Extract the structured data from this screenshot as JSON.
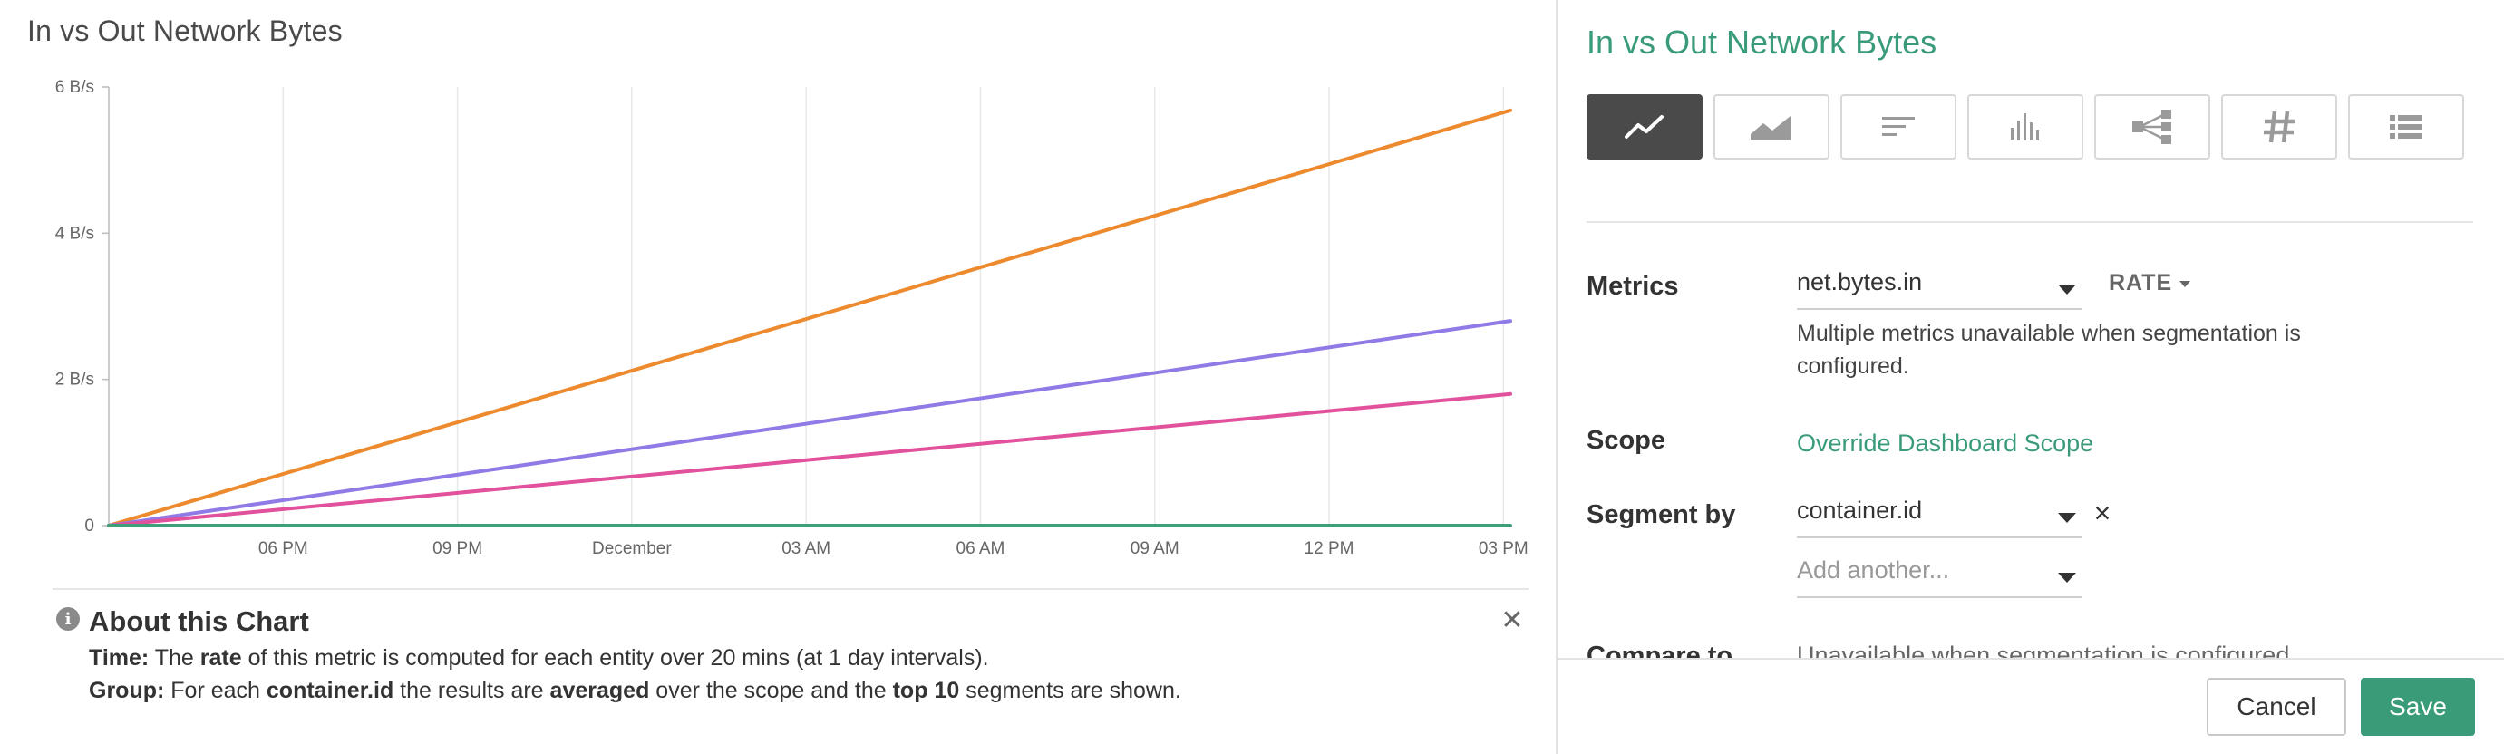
{
  "chart_panel": {
    "title": "In vs Out Network Bytes",
    "about": {
      "heading": "About this Chart",
      "line1": {
        "label": "Time:",
        "t1": "The",
        "rate": "rate",
        "t2": "of this metric is computed for each entity over 20 mins (at 1 day intervals)."
      },
      "line2": {
        "label": "Group:",
        "t1": "For each",
        "entity": "container.id",
        "t2": "the results are",
        "agg": "averaged",
        "t3": "over the scope and the",
        "top": "top 10",
        "t4": "segments are shown."
      }
    }
  },
  "chart_data": {
    "type": "line",
    "title": "In vs Out Network Bytes",
    "x_ticks": [
      "06 PM",
      "09 PM",
      "December",
      "03 AM",
      "06 AM",
      "09 AM",
      "12 PM",
      "03 PM"
    ],
    "y_ticks": [
      "0",
      "2 B/s",
      "4 B/s",
      "6 B/s"
    ],
    "x_range": [
      0,
      24.12
    ],
    "ylim": [
      0,
      6
    ],
    "grid": true,
    "series": [
      {
        "color": "#ee8a2e",
        "x": [
          0,
          24.12
        ],
        "values": [
          0,
          5.68
        ]
      },
      {
        "color": "#8f7ae6",
        "x": [
          0,
          24.12
        ],
        "values": [
          0,
          2.8
        ]
      },
      {
        "color": "#e2519c",
        "x": [
          0,
          24.12
        ],
        "values": [
          0,
          1.8
        ]
      },
      {
        "color": "#3da07b",
        "x": [
          0,
          24.12
        ],
        "values": [
          0,
          0
        ]
      }
    ]
  },
  "editor": {
    "title": "In vs Out Network Bytes",
    "viz_types": [
      {
        "icon": "line-chart-icon",
        "active": true
      },
      {
        "icon": "area-chart-icon",
        "active": false
      },
      {
        "icon": "toplist-icon",
        "active": false
      },
      {
        "icon": "histogram-icon",
        "active": false
      },
      {
        "icon": "topology-icon",
        "active": false
      },
      {
        "icon": "number-icon",
        "active": false
      },
      {
        "icon": "table-icon",
        "active": false
      }
    ],
    "metrics": {
      "label": "Metrics",
      "value": "net.bytes.in",
      "rate": "RATE",
      "help": "Multiple metrics unavailable when segmentation is configured."
    },
    "scope": {
      "label": "Scope",
      "link": "Override Dashboard Scope"
    },
    "segment": {
      "label": "Segment by",
      "value": "container.id",
      "remove": "×",
      "add_placeholder": "Add another..."
    },
    "compare": {
      "label": "Compare to",
      "value": "Unavailable when segmentation is configured"
    },
    "buttons": {
      "cancel": "Cancel",
      "save": "Save"
    },
    "colors": {
      "accent": "#3a9b78",
      "active_viz": "#4a4a4a"
    }
  }
}
